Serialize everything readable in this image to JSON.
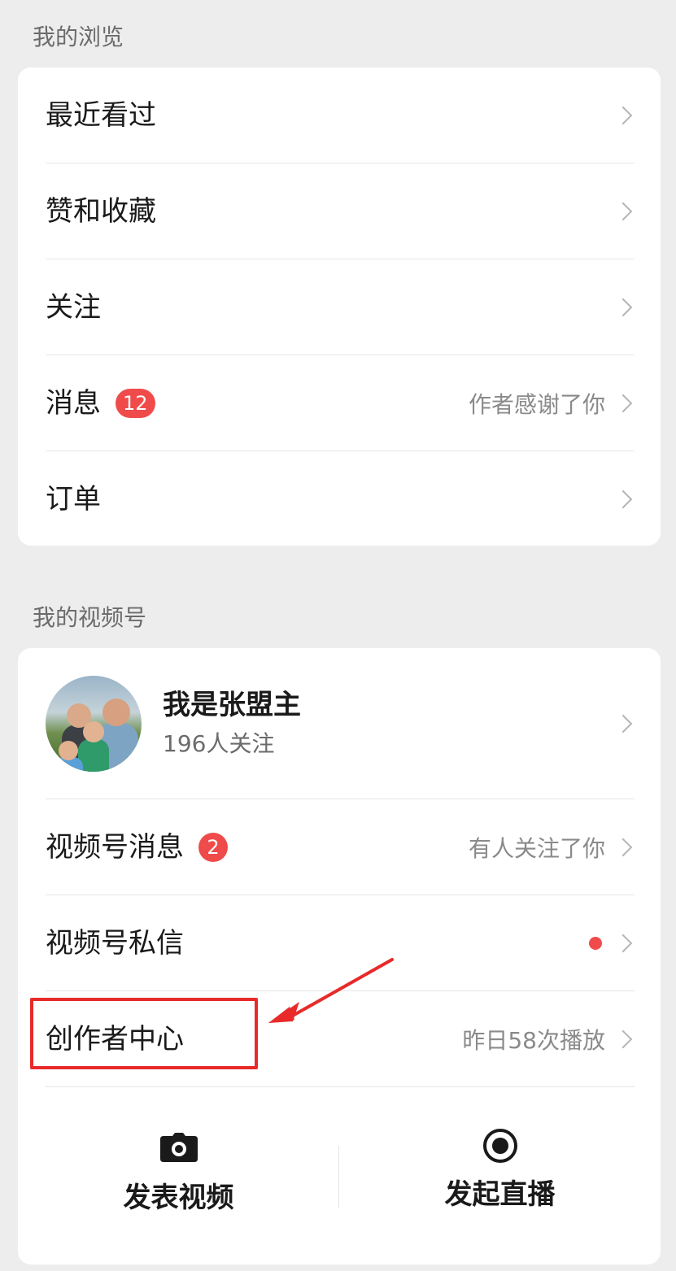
{
  "browse": {
    "title": "我的浏览",
    "items": [
      {
        "label": "最近看过"
      },
      {
        "label": "赞和收藏"
      },
      {
        "label": "关注"
      },
      {
        "label": "消息",
        "badge": "12",
        "hint": "作者感谢了你"
      },
      {
        "label": "订单"
      }
    ]
  },
  "channels": {
    "title": "我的视频号",
    "profile": {
      "name": "我是张盟主",
      "followers": "196人关注"
    },
    "items": [
      {
        "label": "视频号消息",
        "badge": "2",
        "hint": "有人关注了你"
      },
      {
        "label": "视频号私信"
      },
      {
        "label": "创作者中心",
        "hint": "昨日58次播放"
      }
    ],
    "actions": [
      {
        "label": "发表视频",
        "icon": "camera-icon"
      },
      {
        "label": "发起直播",
        "icon": "live-record-icon"
      }
    ]
  },
  "colors": {
    "badge": "#f04b4b",
    "annotation": "#e82a2a",
    "background": "#ededed"
  }
}
